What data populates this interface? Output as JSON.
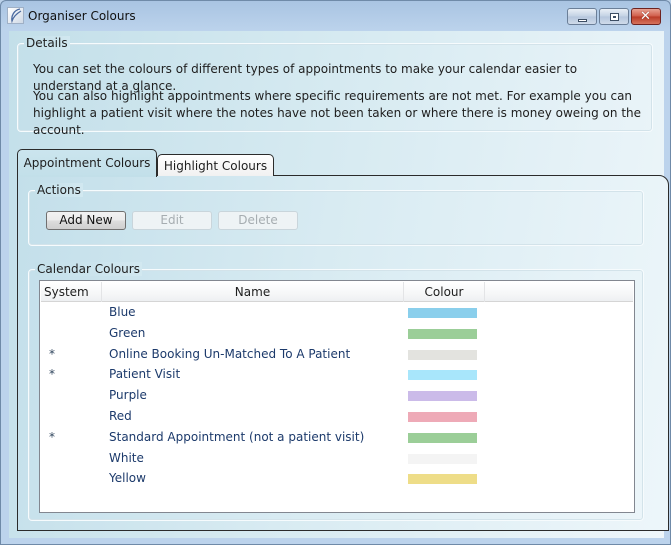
{
  "window": {
    "title": "Organiser Colours",
    "icon": "app-logo-icon",
    "controls": {
      "minimize": "minimize-icon",
      "maximize": "maximize-icon",
      "close": "close-icon"
    }
  },
  "details": {
    "label": "Details",
    "paragraph1": "You can set the colours of different types of appointments to make your calendar easier to understand at a glance.",
    "paragraph2": "You can also highlight appointments where specific requirements are not met. For example you can highlight a patient visit where the notes have not been taken or where there is money oweing on the account."
  },
  "tabs": [
    {
      "label": "Appointment Colours",
      "active": true
    },
    {
      "label": "Highlight Colours",
      "active": false
    }
  ],
  "actions": {
    "label": "Actions",
    "buttons": [
      {
        "label": "Add New",
        "enabled": true
      },
      {
        "label": "Edit",
        "enabled": false
      },
      {
        "label": "Delete",
        "enabled": false
      }
    ]
  },
  "calendar_colours": {
    "label": "Calendar Colours",
    "columns": [
      "System",
      "Name",
      "Colour"
    ],
    "rows": [
      {
        "system": "",
        "name": "Blue",
        "colour": "#8acfec"
      },
      {
        "system": "",
        "name": "Green",
        "colour": "#9bce98"
      },
      {
        "system": "*",
        "name": "Online Booking Un-Matched To A Patient",
        "colour": "#e3e3df"
      },
      {
        "system": "*",
        "name": "Patient Visit",
        "colour": "#a8e6fb"
      },
      {
        "system": "",
        "name": "Purple",
        "colour": "#cbbbe9"
      },
      {
        "system": "",
        "name": "Red",
        "colour": "#eeaab7"
      },
      {
        "system": "*",
        "name": "Standard Appointment (not a patient visit)",
        "colour": "#9bce98"
      },
      {
        "system": "",
        "name": "White",
        "colour": "#f4f4f4"
      },
      {
        "system": "",
        "name": "Yellow",
        "colour": "#eedd88"
      }
    ]
  }
}
